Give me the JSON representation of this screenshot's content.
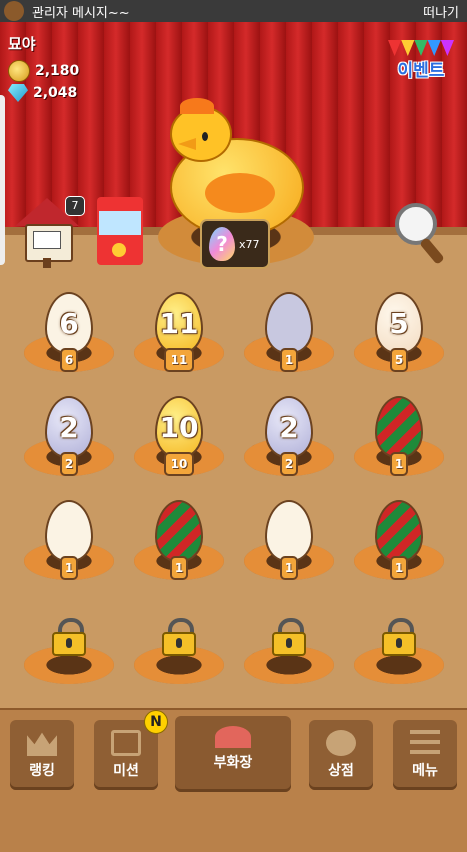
{
  "topbar": {
    "message": "관리자 메시지~~",
    "leave_label": "떠나기"
  },
  "player": {
    "name": "묘야",
    "coins": "2,180",
    "gems": "2,048"
  },
  "event": {
    "label": "이벤트"
  },
  "mailbox": {
    "count": "7"
  },
  "mystery_egg": {
    "symbol": "?",
    "count": "x77"
  },
  "eggs": [
    {
      "type": "white",
      "number": "6",
      "level": "6"
    },
    {
      "type": "gold",
      "number": "11",
      "level": "11"
    },
    {
      "type": "gray",
      "number": "",
      "level": "1"
    },
    {
      "type": "cream",
      "number": "5",
      "level": "5"
    },
    {
      "type": "lav",
      "number": "2",
      "level": "2"
    },
    {
      "type": "gold",
      "number": "10",
      "level": "10"
    },
    {
      "type": "lav",
      "number": "2",
      "level": "2"
    },
    {
      "type": "xmas",
      "number": "",
      "level": "1"
    },
    {
      "type": "white",
      "number": "",
      "level": "1"
    },
    {
      "type": "xmas",
      "number": "",
      "level": "1"
    },
    {
      "type": "white",
      "number": "",
      "level": "1"
    },
    {
      "type": "xmas",
      "number": "",
      "level": "1"
    }
  ],
  "nav": {
    "ranking": "랭킹",
    "mission": "미션",
    "mission_badge": "N",
    "incubator": "부화장",
    "shop": "상점",
    "menu": "메뉴"
  }
}
